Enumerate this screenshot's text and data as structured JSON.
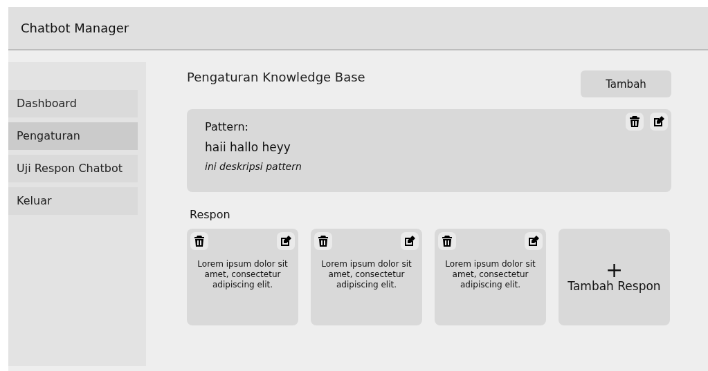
{
  "header": {
    "title": "Chatbot Manager"
  },
  "sidebar": {
    "items": [
      {
        "label": "Dashboard",
        "selected": false
      },
      {
        "label": "Pengaturan",
        "selected": true
      },
      {
        "label": "Uji Respon Chatbot",
        "selected": false
      },
      {
        "label": "Keluar",
        "selected": false
      }
    ]
  },
  "page": {
    "title": "Pengaturan Knowledge Base",
    "add_button": "Tambah"
  },
  "pattern": {
    "label": "Pattern:",
    "value": "haii hallo heyy",
    "description": "ini deskripsi pattern"
  },
  "responses": {
    "title": "Respon",
    "items": [
      {
        "text": "Lorem ipsum dolor sit amet, consectetur adipiscing elit."
      },
      {
        "text": "Lorem ipsum dolor sit amet, consectetur adipiscing elit."
      },
      {
        "text": "Lorem ipsum dolor sit amet, consectetur adipiscing elit."
      }
    ],
    "add": {
      "icon": "+",
      "label": "Tambah Respon"
    }
  }
}
